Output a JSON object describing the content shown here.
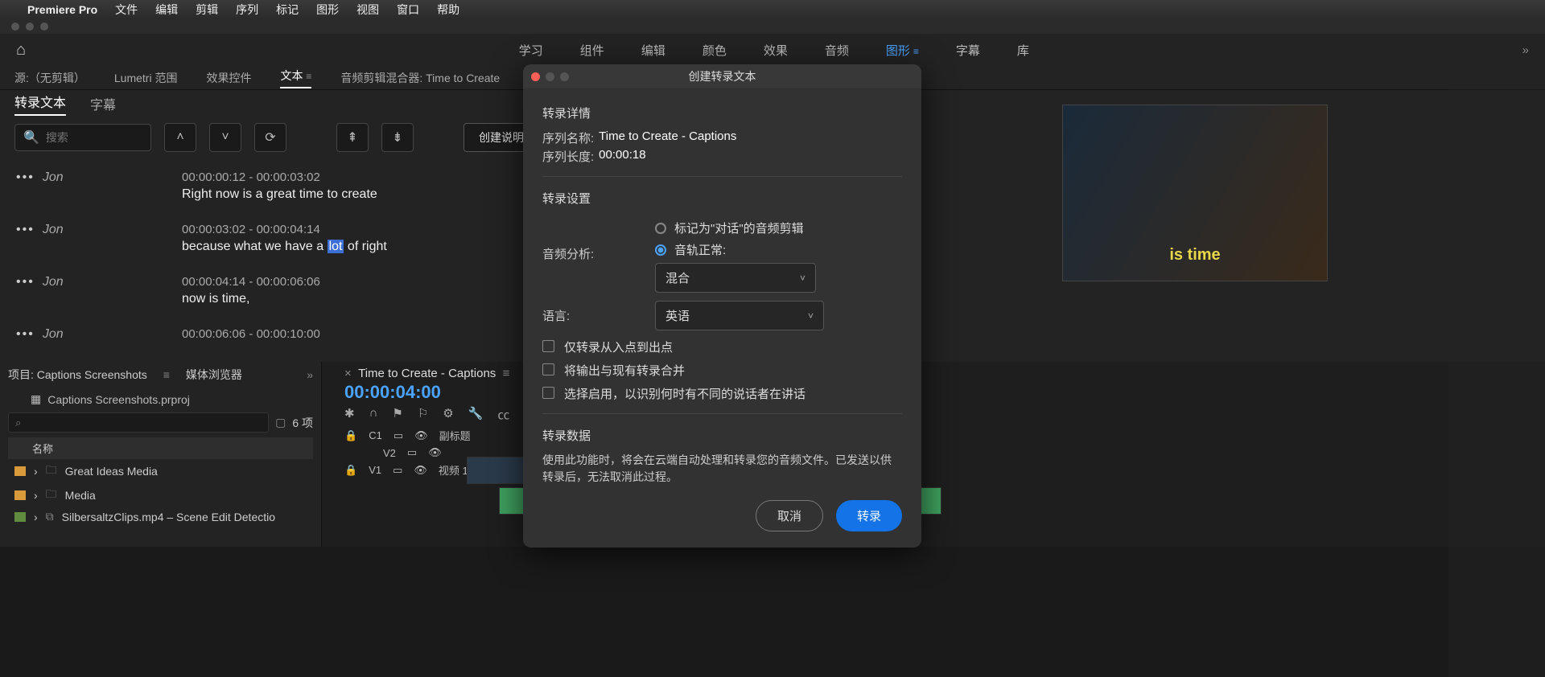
{
  "menubar": {
    "app": "Premiere Pro",
    "items": [
      "文件",
      "编辑",
      "剪辑",
      "序列",
      "标记",
      "图形",
      "视图",
      "窗口",
      "帮助"
    ]
  },
  "workspace": {
    "tabs": [
      "学习",
      "组件",
      "编辑",
      "颜色",
      "效果",
      "音频",
      "图形",
      "字幕",
      "库"
    ],
    "active": "图形"
  },
  "source_tabs": {
    "items": [
      "源:（无剪辑）",
      "Lumetri 范围",
      "效果控件",
      "文本",
      "音频剪辑混合器: Time to Create"
    ],
    "active": "文本"
  },
  "transcript_sub": {
    "items": [
      "转录文本",
      "字幕"
    ],
    "active": "转录文本"
  },
  "toolbar": {
    "search_placeholder": "搜索",
    "create_captions": "创建说明性字幕"
  },
  "transcript": [
    {
      "speaker": "Jon",
      "time": "00:00:00:12 - 00:00:03:02",
      "text_pre": "Right now is a great time to create",
      "hl": "",
      "text_post": ""
    },
    {
      "speaker": "Jon",
      "time": "00:00:03:02 - 00:00:04:14",
      "text_pre": "because what we have a ",
      "hl": "lot",
      "text_post": " of right"
    },
    {
      "speaker": "Jon",
      "time": "00:00:04:14 - 00:00:06:06",
      "text_pre": "now is time,",
      "hl": "",
      "text_post": ""
    },
    {
      "speaker": "Jon",
      "time": "00:00:06:06 - 00:00:10:00",
      "text_pre": "",
      "hl": "",
      "text_post": ""
    }
  ],
  "project": {
    "tab1": "项目: Captions Screenshots",
    "tab2": "媒体浏览器",
    "path": "Captions Screenshots.prproj",
    "count": "6 项",
    "header": "名称",
    "items": [
      {
        "type": "bin",
        "name": "Great Ideas Media"
      },
      {
        "type": "bin",
        "name": "Media"
      },
      {
        "type": "clip",
        "name": "SilbersaltzClips.mp4 – Scene Edit Detectio"
      }
    ]
  },
  "timeline": {
    "title": "Time to Create - Captions",
    "timecode": "00:00:04:00",
    "subtitle_track": "副标题",
    "v2": "V2",
    "v1": "V1",
    "video1": "视频 1",
    "c1": "C1"
  },
  "preview": {
    "caption_text": "is time"
  },
  "modal": {
    "title": "创建转录文本",
    "section_details": "转录详情",
    "seq_name_label": "序列名称:",
    "seq_name": "Time to Create - Captions",
    "seq_len_label": "序列长度:",
    "seq_len": "00:00:18",
    "section_settings": "转录设置",
    "audio_analysis_label": "音频分析:",
    "radio_dialogue": "标记为\"对话\"的音频剪辑",
    "radio_track": "音轨正常:",
    "mix_select": "混合",
    "language_label": "语言:",
    "language_value": "英语",
    "check_inout": "仅转录从入点到出点",
    "check_merge": "将输出与现有转录合并",
    "check_speakers": "选择启用，以识别何时有不同的说话者在讲话",
    "section_data": "转录数据",
    "note": "使用此功能时，将会在云端自动处理和转录您的音频文件。已发送以供转录后，无法取消此过程。",
    "cancel": "取消",
    "submit": "转录"
  }
}
